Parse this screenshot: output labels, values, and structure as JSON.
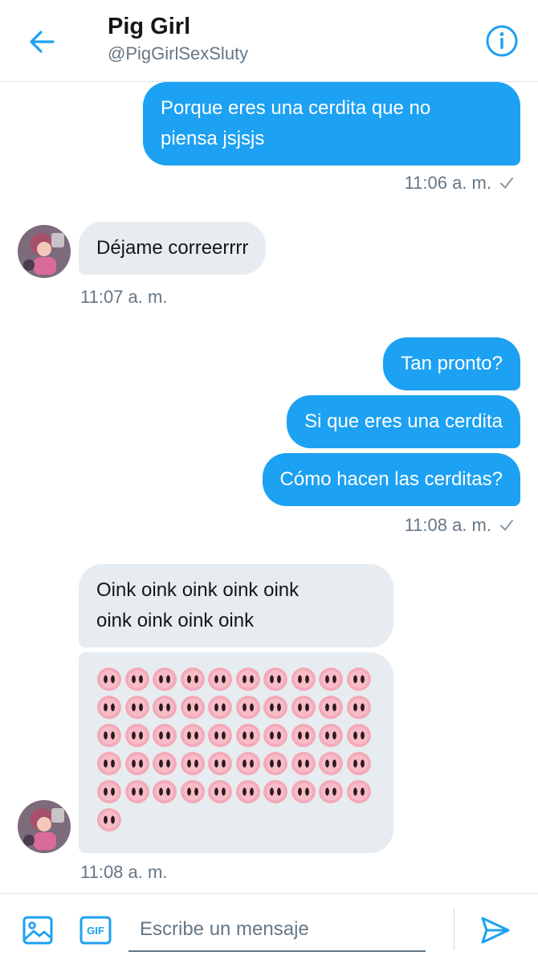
{
  "header": {
    "title": "Pig Girl",
    "handle": "@PigGirlSexSluty",
    "back_icon": "arrow-left-icon",
    "info_icon": "info-circle-icon"
  },
  "colors": {
    "accent": "#1da1f2",
    "received_bubble": "#e6ecf0",
    "secondary_text": "#657786"
  },
  "messages": {
    "m1": {
      "direction": "sent",
      "text_line1": "Porque eres una cerdita que no",
      "text_line2": "piensa jsjsjs",
      "time": "11:06 a. m."
    },
    "m2": {
      "direction": "received",
      "text": "Déjame correerrrr",
      "time": "11:07 a. m."
    },
    "m3": {
      "direction": "sent",
      "text": "Tan pronto?"
    },
    "m4": {
      "direction": "sent",
      "text": "Si que eres una cerdita"
    },
    "m5": {
      "direction": "sent",
      "text": "Cómo hacen las cerditas?",
      "time": "11:08 a. m."
    },
    "m6": {
      "direction": "received",
      "text_line1": "Oink oink oink oink oink",
      "text_line2": "oink oink oink oink"
    },
    "m7": {
      "direction": "received",
      "emoji": "pig-nose",
      "emoji_count": 51,
      "time": "11:08 a. m."
    }
  },
  "composer": {
    "placeholder": "Escribe un mensaje",
    "media_icon": "image-icon",
    "gif_label": "GIF",
    "send_icon": "send-icon"
  }
}
